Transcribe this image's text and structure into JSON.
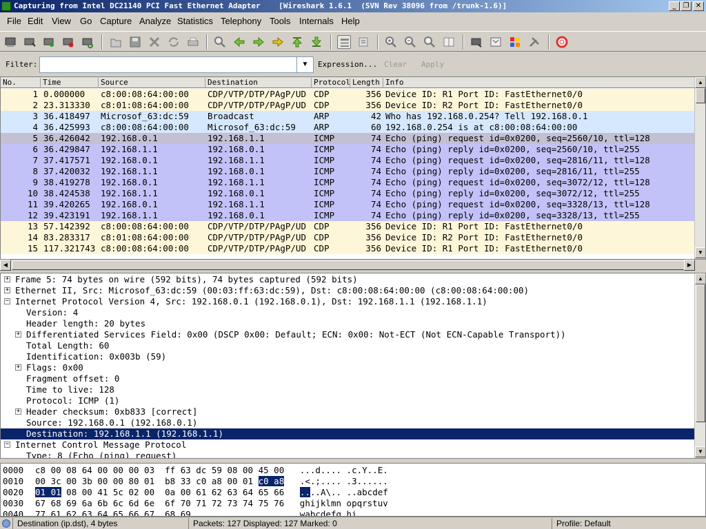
{
  "window": {
    "title": "Capturing from Intel DC21140 PCI Fast Ethernet Adapter    [Wireshark 1.6.1  (SVN Rev 38096 from /trunk-1.6)]"
  },
  "menu": [
    "File",
    "Edit",
    "View",
    "Go",
    "Capture",
    "Analyze",
    "Statistics",
    "Telephony",
    "Tools",
    "Internals",
    "Help"
  ],
  "filter": {
    "label": "Filter:",
    "value": "",
    "expression": "Expression...",
    "clear": "Clear",
    "apply": "Apply"
  },
  "packet_list": {
    "columns": [
      "No.",
      "Time",
      "Source",
      "Destination",
      "Protocol",
      "Length",
      "Info"
    ],
    "rows": [
      {
        "no": "1",
        "time": "0.000000",
        "src": "c8:00:08:64:00:00",
        "dst": "CDP/VTP/DTP/PAgP/UD",
        "proto": "CDP",
        "len": "356",
        "info": "Device ID: R1  Port ID: FastEthernet0/0",
        "bg": "#fef6d8",
        "fg": "#000000"
      },
      {
        "no": "2",
        "time": "23.313330",
        "src": "c8:01:08:64:00:00",
        "dst": "CDP/VTP/DTP/PAgP/UD",
        "proto": "CDP",
        "len": "356",
        "info": "Device ID: R2  Port ID: FastEthernet0/0",
        "bg": "#fef6d8",
        "fg": "#000000"
      },
      {
        "no": "3",
        "time": "36.418497",
        "src": "Microsof_63:dc:59",
        "dst": "Broadcast",
        "proto": "ARP",
        "len": "42",
        "info": "Who has 192.168.0.254?  Tell 192.168.0.1",
        "bg": "#d6e8fe",
        "fg": "#000000"
      },
      {
        "no": "4",
        "time": "36.425993",
        "src": "c8:00:08:64:00:00",
        "dst": "Microsof_63:dc:59",
        "proto": "ARP",
        "len": "60",
        "info": "192.168.0.254 is at c8:00:08:64:00:00",
        "bg": "#d6e8fe",
        "fg": "#000000"
      },
      {
        "no": "5",
        "time": "36.426042",
        "src": "192.168.0.1",
        "dst": "192.168.1.1",
        "proto": "ICMP",
        "len": "74",
        "info": "Echo (ping) request  id=0x0200, seq=2560/10, ttl=128",
        "bg": "#c2c0d2",
        "fg": "#000000"
      },
      {
        "no": "6",
        "time": "36.429847",
        "src": "192.168.1.1",
        "dst": "192.168.0.1",
        "proto": "ICMP",
        "len": "74",
        "info": "Echo (ping) reply    id=0x0200, seq=2560/10, ttl=255",
        "bg": "#c2c2f8",
        "fg": "#000000"
      },
      {
        "no": "7",
        "time": "37.417571",
        "src": "192.168.0.1",
        "dst": "192.168.1.1",
        "proto": "ICMP",
        "len": "74",
        "info": "Echo (ping) request  id=0x0200, seq=2816/11, ttl=128",
        "bg": "#c2c2f8",
        "fg": "#000000"
      },
      {
        "no": "8",
        "time": "37.420032",
        "src": "192.168.1.1",
        "dst": "192.168.0.1",
        "proto": "ICMP",
        "len": "74",
        "info": "Echo (ping) reply    id=0x0200, seq=2816/11, ttl=255",
        "bg": "#c2c2f8",
        "fg": "#000000"
      },
      {
        "no": "9",
        "time": "38.419278",
        "src": "192.168.0.1",
        "dst": "192.168.1.1",
        "proto": "ICMP",
        "len": "74",
        "info": "Echo (ping) request  id=0x0200, seq=3072/12, ttl=128",
        "bg": "#c2c2f8",
        "fg": "#000000"
      },
      {
        "no": "10",
        "time": "38.424538",
        "src": "192.168.1.1",
        "dst": "192.168.0.1",
        "proto": "ICMP",
        "len": "74",
        "info": "Echo (ping) reply    id=0x0200, seq=3072/12, ttl=255",
        "bg": "#c2c2f8",
        "fg": "#000000"
      },
      {
        "no": "11",
        "time": "39.420265",
        "src": "192.168.0.1",
        "dst": "192.168.1.1",
        "proto": "ICMP",
        "len": "74",
        "info": "Echo (ping) request  id=0x0200, seq=3328/13, ttl=128",
        "bg": "#c2c2f8",
        "fg": "#000000"
      },
      {
        "no": "12",
        "time": "39.423191",
        "src": "192.168.1.1",
        "dst": "192.168.0.1",
        "proto": "ICMP",
        "len": "74",
        "info": "Echo (ping) reply    id=0x0200, seq=3328/13, ttl=255",
        "bg": "#c2c2f8",
        "fg": "#000000"
      },
      {
        "no": "13",
        "time": "57.142392",
        "src": "c8:00:08:64:00:00",
        "dst": "CDP/VTP/DTP/PAgP/UD",
        "proto": "CDP",
        "len": "356",
        "info": "Device ID: R1  Port ID: FastEthernet0/0",
        "bg": "#fef6d8",
        "fg": "#000000"
      },
      {
        "no": "14",
        "time": "83.283317",
        "src": "c8:01:08:64:00:00",
        "dst": "CDP/VTP/DTP/PAgP/UD",
        "proto": "CDP",
        "len": "356",
        "info": "Device ID: R2  Port ID: FastEthernet0/0",
        "bg": "#fef6d8",
        "fg": "#000000"
      },
      {
        "no": "15",
        "time": "117.321743",
        "src": "c8:00:08:64:00:00",
        "dst": "CDP/VTP/DTP/PAgP/UD",
        "proto": "CDP",
        "len": "356",
        "info": "Device ID: R1  Port ID: FastEthernet0/0",
        "bg": "#fef6d8",
        "fg": "#000000"
      }
    ]
  },
  "details": [
    {
      "text": "Frame 5: 74 bytes on wire (592 bits), 74 bytes captured (592 bits)",
      "indent": 0,
      "exp": "+"
    },
    {
      "text": "Ethernet II, Src: Microsof_63:dc:59 (00:03:ff:63:dc:59), Dst: c8:00:08:64:00:00 (c8:00:08:64:00:00)",
      "indent": 0,
      "exp": "+"
    },
    {
      "text": "Internet Protocol Version 4, Src: 192.168.0.1 (192.168.0.1), Dst: 192.168.1.1 (192.168.1.1)",
      "indent": 0,
      "exp": "-"
    },
    {
      "text": "Version: 4",
      "indent": 1,
      "exp": ""
    },
    {
      "text": "Header length: 20 bytes",
      "indent": 1,
      "exp": ""
    },
    {
      "text": "Differentiated Services Field: 0x00 (DSCP 0x00: Default; ECN: 0x00: Not-ECT (Not ECN-Capable Transport))",
      "indent": 1,
      "exp": "+"
    },
    {
      "text": "Total Length: 60",
      "indent": 1,
      "exp": ""
    },
    {
      "text": "Identification: 0x003b (59)",
      "indent": 1,
      "exp": ""
    },
    {
      "text": "Flags: 0x00",
      "indent": 1,
      "exp": "+"
    },
    {
      "text": "Fragment offset: 0",
      "indent": 1,
      "exp": ""
    },
    {
      "text": "Time to live: 128",
      "indent": 1,
      "exp": ""
    },
    {
      "text": "Protocol: ICMP (1)",
      "indent": 1,
      "exp": ""
    },
    {
      "text": "Header checksum: 0xb833 [correct]",
      "indent": 1,
      "exp": "+"
    },
    {
      "text": "Source: 192.168.0.1 (192.168.0.1)",
      "indent": 1,
      "exp": ""
    },
    {
      "text": "Destination: 192.168.1.1 (192.168.1.1)",
      "indent": 1,
      "exp": "",
      "selected": true
    },
    {
      "text": "Internet Control Message Protocol",
      "indent": 0,
      "exp": "-"
    },
    {
      "text": "Type: 8 (Echo (ping) request)",
      "indent": 1,
      "exp": ""
    }
  ],
  "hex": [
    {
      "off": "0000",
      "parts": [
        {
          "t": "c8 00 08 64 00 00 00 03  ff 63 dc 59 08 00 45 00   ...d.... .c.Y..E."
        }
      ]
    },
    {
      "off": "0010",
      "parts": [
        {
          "t": "00 3c 00 3b 00 00 80 01  b8 33 c0 a8 00 01 "
        },
        {
          "t": "c0 a8",
          "hl": true
        },
        {
          "t": "   .<.;.... .3......"
        }
      ]
    },
    {
      "off": "0020",
      "parts": [
        {
          "t": "01 01",
          "hl": true
        },
        {
          "t": " 08 00 41 5c 02 00  0a 00 61 62 63 64 65 66   "
        },
        {
          "t": "..",
          "hl": true
        },
        {
          "t": "..A\\.. ..abcdef"
        }
      ]
    },
    {
      "off": "0030",
      "parts": [
        {
          "t": "67 68 69 6a 6b 6c 6d 6e  6f 70 71 72 73 74 75 76   ghijklmn opqrstuv"
        }
      ]
    },
    {
      "off": "0040",
      "parts": [
        {
          "t": "77 61 62 63 64 65 66 67  68 69                     wabcdefg hi"
        }
      ]
    }
  ],
  "status": {
    "field": "Destination (ip.dst), 4 bytes",
    "packets": "Packets: 127 Displayed: 127 Marked: 0",
    "profile": "Profile: Default"
  },
  "toolbar_icons": [
    "interfaces-icon",
    "capture-options-icon",
    "start-capture-icon",
    "stop-capture-icon",
    "restart-capture-icon",
    "open-file-icon",
    "save-file-icon",
    "close-file-icon",
    "reload-icon",
    "print-icon",
    "find-icon",
    "back-icon",
    "forward-icon",
    "go-to-packet-icon",
    "first-packet-icon",
    "last-packet-icon",
    "colorize-icon",
    "autoscroll-icon",
    "zoom-in-icon",
    "zoom-out-icon",
    "normal-size-icon",
    "resize-columns-icon",
    "capture-filters-icon",
    "display-filters-icon",
    "coloring-rules-icon",
    "preferences-icon",
    "help-icon"
  ],
  "colors": {
    "selection": "#0a246a",
    "cdp_row": "#fef6d8",
    "arp_row": "#d6e8fe",
    "icmp_row": "#c2c2f8",
    "icmp_first_row": "#c2c0d2"
  }
}
